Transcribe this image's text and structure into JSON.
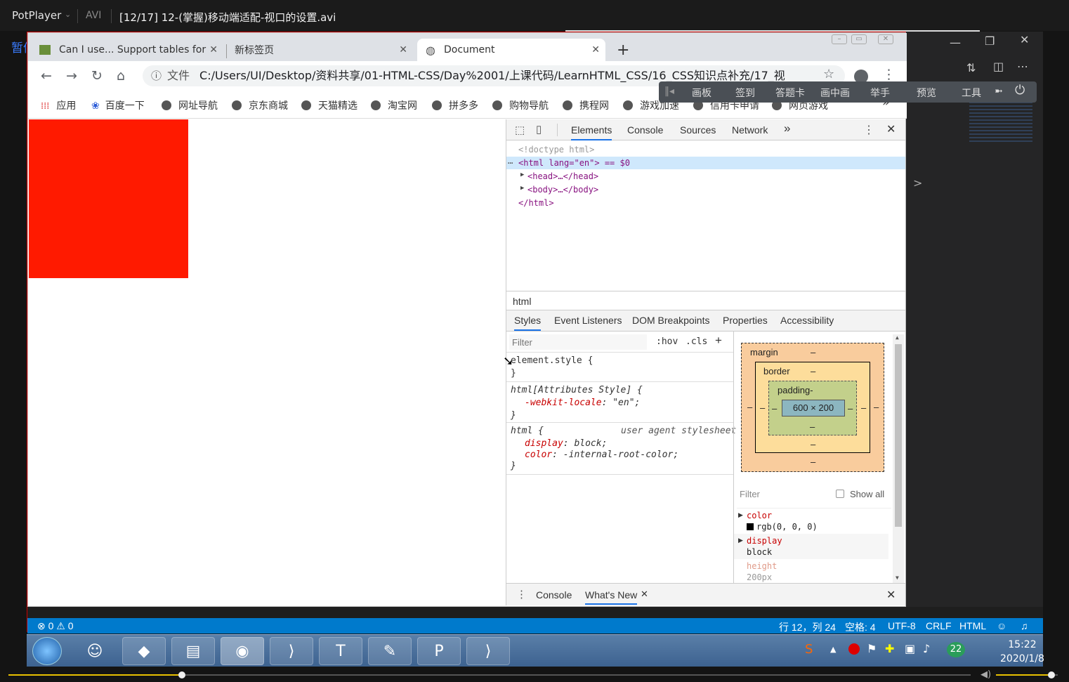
{
  "player": {
    "name": "PotPlayer",
    "format": "AVI",
    "title": "[12/17] 12-(掌握)移动端适配-视口的设置.avi",
    "pause_label": "暂停",
    "progress": 0.18,
    "volume": 0.9
  },
  "browser": {
    "tabs": [
      {
        "label": "Can I use... Support tables for"
      },
      {
        "label": "新标签页"
      },
      {
        "label": "Document"
      }
    ],
    "new_tab": "+",
    "address_prefix": "文件",
    "address": "C:/Users/UI/Desktop/资料共享/01-HTML-CSS/Day%2001/上课代码/LearnHTML_CSS/16_CSS知识点补充/17_视",
    "bookmarks": [
      "应用",
      "百度一下",
      "网址导航",
      "京东商城",
      "天猫精选",
      "淘宝网",
      "拼多多",
      "购物导航",
      "携程网",
      "游戏加速",
      "信用卡申请",
      "网页游戏"
    ],
    "more": "»"
  },
  "floatbar": {
    "items": [
      "画板",
      "签到",
      "答题卡",
      "画中画",
      "举手",
      "预览",
      "工具"
    ]
  },
  "page": {
    "box_color": "#ff1a00"
  },
  "devtools": {
    "tabs": [
      "Elements",
      "Console",
      "Sources",
      "Network",
      "»"
    ],
    "dom": {
      "doctype": "<!doctype html>",
      "html_open": "<html lang=\"en\"> == $0",
      "head": "<head>…</head>",
      "body": "<body>…</body>",
      "html_close": "</html>"
    },
    "breadcrumb": "html",
    "subtabs": [
      "Styles",
      "Event Listeners",
      "DOM Breakpoints",
      "Properties",
      "Accessibility"
    ],
    "filter_placeholder": "Filter",
    "hov": ":hov",
    "cls": ".cls",
    "plus": "+",
    "rules": {
      "element_style": "element.style {",
      "close": "}",
      "attr_selector": "html[Attributes Style] {",
      "attr_prop": "-webkit-locale",
      "attr_val": ": \"en\";",
      "ua_selector": "html {",
      "ua_label": "user agent stylesheet",
      "display_prop": "display",
      "display_val": ": block;",
      "color_prop": "color",
      "color_val": ": -internal-root-color;"
    },
    "boxmodel": {
      "margin": "margin",
      "border": "border",
      "padding": "padding-",
      "content": "600 × 200",
      "dash": "–"
    },
    "computed": {
      "filter": "Filter",
      "show_all": "Show all",
      "items": [
        {
          "name": "color",
          "value": "rgb(0, 0, 0)"
        },
        {
          "name": "display",
          "value": "block"
        },
        {
          "name": "height",
          "value": "200px"
        }
      ]
    },
    "drawer": {
      "tabs": [
        "Console",
        "What's New"
      ]
    }
  },
  "statusbar": {
    "problems": "⊗ 0 ⚠ 0",
    "position": "行 12，列 24",
    "spaces": "空格: 4",
    "encoding": "UTF-8",
    "eol": "CRLF",
    "language": "HTML"
  },
  "taskbar": {
    "time": "15:22",
    "date": "2020/1/8",
    "badge": "22"
  }
}
